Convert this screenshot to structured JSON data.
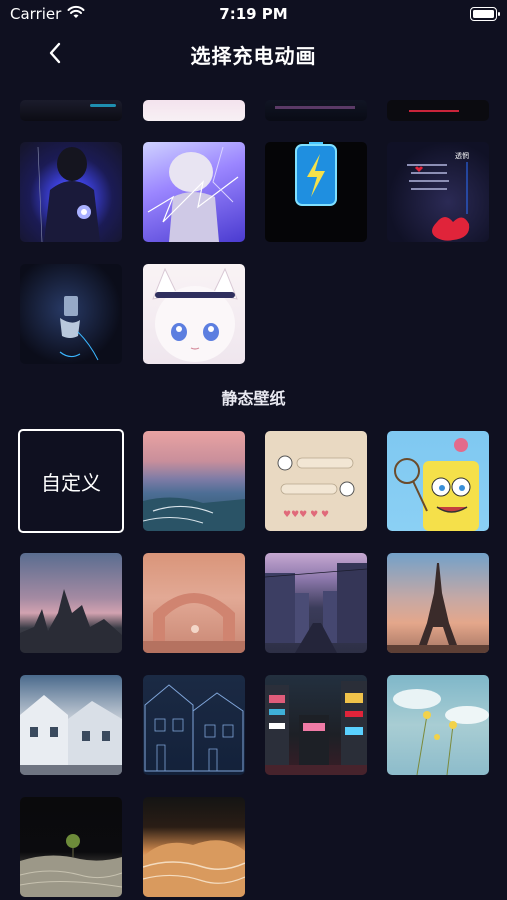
{
  "status_bar": {
    "carrier": "Carrier",
    "time": "7:19 PM",
    "wifi_icon": "wifi-icon",
    "battery_icon": "battery-icon"
  },
  "nav": {
    "title": "选择充电动画",
    "back_icon": "chevron-left-icon"
  },
  "sections": {
    "animations": {
      "items": [
        "dark-partial",
        "pink-partial",
        "neon-partial",
        "red-partial",
        "gothic-girl",
        "anime-lightning",
        "battery-bolt",
        "text-apple",
        "glow-figure",
        "cat-ear-girl"
      ]
    },
    "static_wallpapers": {
      "title": "静态壁纸",
      "custom_label": "自定义",
      "items": [
        "sunset-sea",
        "chat-stickers",
        "spongebob",
        "pink-rocks",
        "arch-sunset",
        "japanese-street",
        "eiffel-tower",
        "snowy-houses",
        "line-art-houses",
        "city-night",
        "yellow-flowers",
        "moon-tree",
        "orange-canyon"
      ]
    }
  },
  "colors": {
    "background": "#0f1020",
    "text": "#ffffff",
    "accent_blue": "#3bb6ff",
    "accent_red": "#e0243a"
  }
}
